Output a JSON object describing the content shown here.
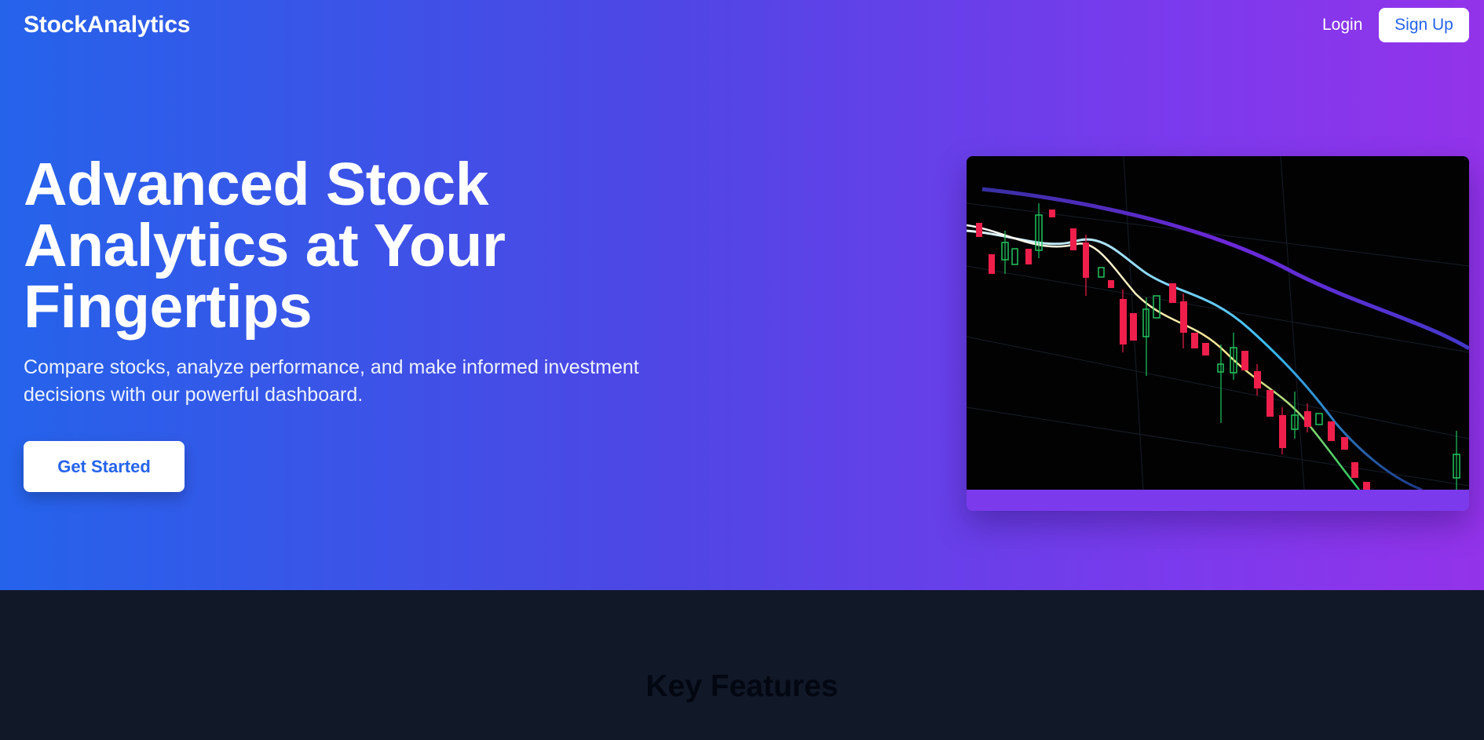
{
  "nav": {
    "brand": "StockAnalytics",
    "login_label": "Login",
    "signup_label": "Sign Up"
  },
  "hero": {
    "headline_lines": [
      "Advanced Stock",
      "Analytics at Your",
      "Fingertips"
    ],
    "subtitle_lines": [
      "Compare stocks, analyze performance, and make informed investment",
      "decisions with our powerful dashboard."
    ],
    "cta_label": "Get Started",
    "image": "candlestick-chart-photo"
  },
  "features": {
    "title": "Key Features"
  },
  "colors": {
    "gradient_start": "#2563eb",
    "gradient_end": "#9333ea",
    "accent_text": "#2563eb",
    "dark_section": "#111827",
    "candle_up": "#22c55e",
    "candle_down": "#ef1f4b"
  }
}
